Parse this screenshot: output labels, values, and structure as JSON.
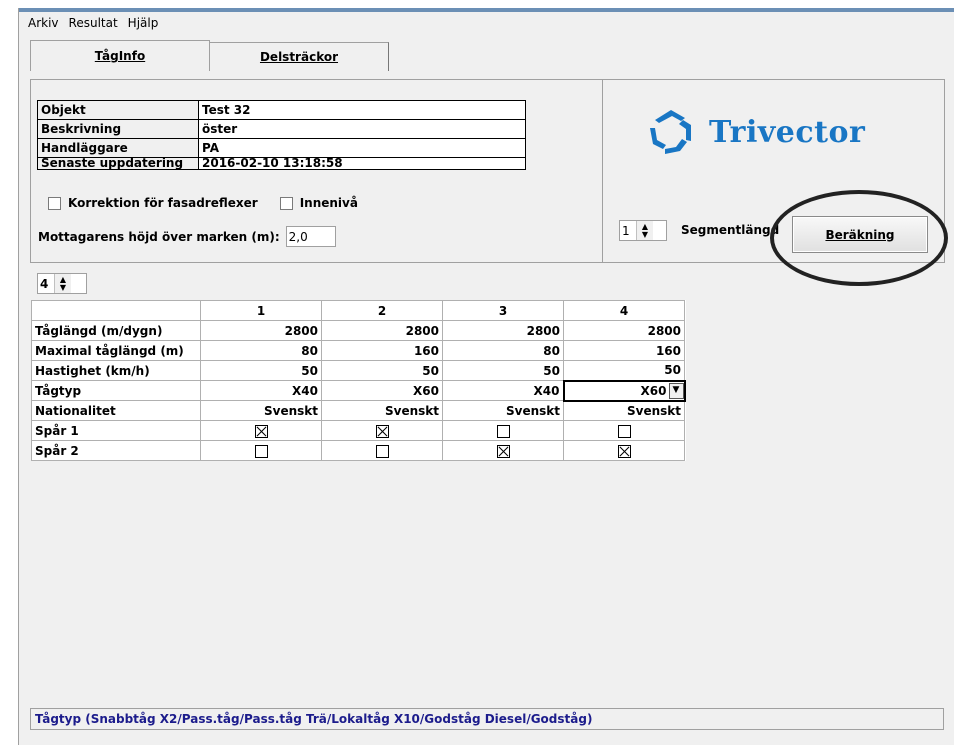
{
  "menu": [
    "Arkiv",
    "Resultat",
    "Hjälp"
  ],
  "tabs": {
    "tab1": "TågInfo",
    "tab2": "Delsträckor"
  },
  "info": {
    "rows": [
      {
        "label": "Objekt",
        "value": "Test 32"
      },
      {
        "label": "Beskrivning",
        "value": "öster"
      },
      {
        "label": "Handläggare",
        "value": "PA"
      },
      {
        "label": "Senaste uppdatering",
        "value": "2016-02-10 13:18:58"
      }
    ]
  },
  "options": {
    "korrektion_label": "Korrektion för fasadreflexer",
    "korrektion_checked": false,
    "innen_label": "Innenivå",
    "innen_checked": false
  },
  "height": {
    "label": "Mottagarens höjd över marken (m):",
    "value": "2,0"
  },
  "logo": {
    "text": "Trivector",
    "color": "#1976c4"
  },
  "segment": {
    "value": "1",
    "label": "Segmentlängd"
  },
  "calc_button": "Beräkning",
  "train_count": "4",
  "grid": {
    "columns": [
      "1",
      "2",
      "3",
      "4"
    ],
    "rows": [
      {
        "label": "Tåglängd (m/dygn)",
        "values": [
          "2800",
          "2800",
          "2800",
          "2800"
        ]
      },
      {
        "label": "Maximal tåglängd (m)",
        "values": [
          "80",
          "160",
          "80",
          "160"
        ]
      },
      {
        "label": "Hastighet (km/h)",
        "values": [
          "50",
          "50",
          "50",
          "50"
        ]
      },
      {
        "label": "Tågtyp",
        "values": [
          "X40",
          "X60",
          "X40",
          "X60"
        ]
      },
      {
        "label": "Nationalitet",
        "values": [
          "Svenskt",
          "Svenskt",
          "Svenskt",
          "Svenskt"
        ]
      }
    ],
    "track_rows": [
      {
        "label": "Spår 1",
        "checked": [
          true,
          true,
          false,
          false
        ]
      },
      {
        "label": "Spår 2",
        "checked": [
          false,
          false,
          true,
          true
        ]
      }
    ]
  },
  "status": "Tågtyp (Snabbtåg X2/Pass.tåg/Pass.tåg Trä/Lokaltåg X10/Godståg Diesel/Godståg)"
}
